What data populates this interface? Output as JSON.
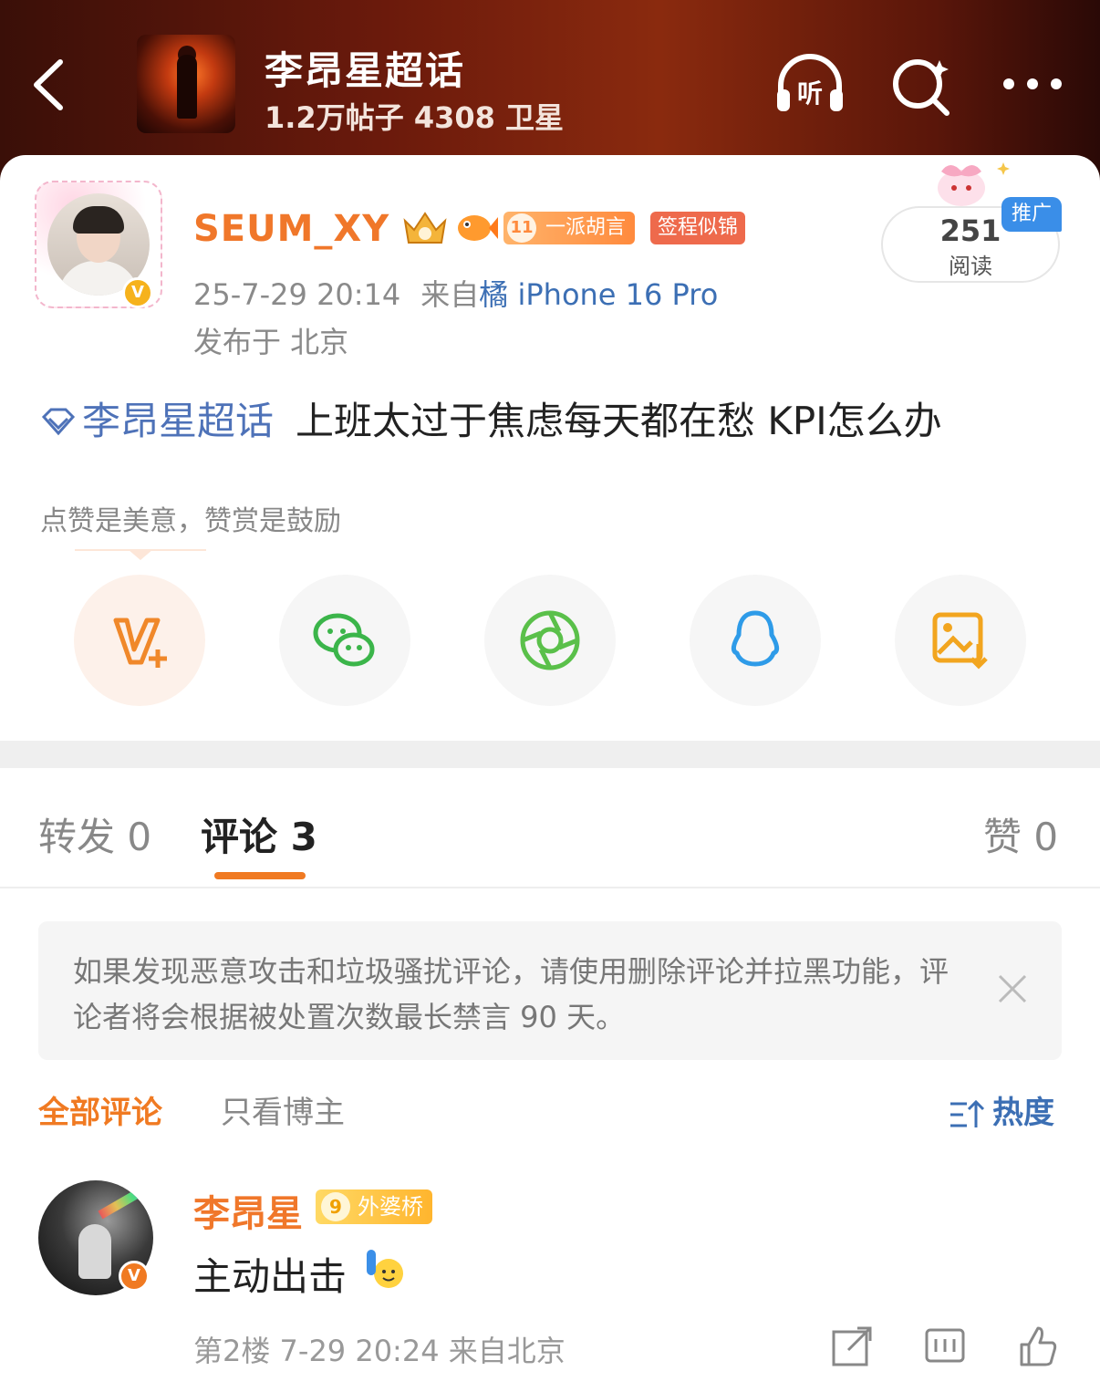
{
  "header": {
    "topic_title": "李昂星超话",
    "topic_stats": "1.2万帖子 4308 卫星",
    "listen_icon_text": "听",
    "icons": [
      "back-icon",
      "listen-icon",
      "search-icon",
      "more-icon"
    ]
  },
  "post": {
    "username": "SEUM_XY",
    "level_num": "11",
    "level_title": "一派胡言",
    "tag": "签程似锦",
    "timestamp": "25-7-29 20:14",
    "source_prefix": "来自",
    "device": "橘 iPhone 16 Pro",
    "location": "发布于 北京",
    "reads_count": "251",
    "reads_label": "阅读",
    "promo_label": "推广",
    "topic_link": "李昂星超话",
    "text": "上班太过于焦虑每天都在愁 KPI怎么办",
    "reward_hint": "点赞是美意，赞赏是鼓励",
    "share_buttons": [
      "v-plus-icon",
      "wechat-icon",
      "moments-icon",
      "qq-icon",
      "save-image-icon"
    ]
  },
  "tabs": {
    "repost": "转发 0",
    "comment": "评论 3",
    "like": "赞 0"
  },
  "notice": {
    "text": "如果发现恶意攻击和垃圾骚扰评论，请使用删除评论并拉黑功能，评论者将会根据被处置次数最长禁言 90 天。"
  },
  "filters": {
    "all": "全部评论",
    "owner_only": "只看博主",
    "sort": "热度"
  },
  "comment": {
    "name": "李昂星",
    "badge_num": "9",
    "badge_title": "外婆桥",
    "text": "主动出击",
    "meta": "第2楼 7-29 20:24 来自北京"
  },
  "colors": {
    "accent_orange": "#f07a22",
    "link_blue": "#3c6fb4",
    "header_dark": "#5a160a"
  }
}
